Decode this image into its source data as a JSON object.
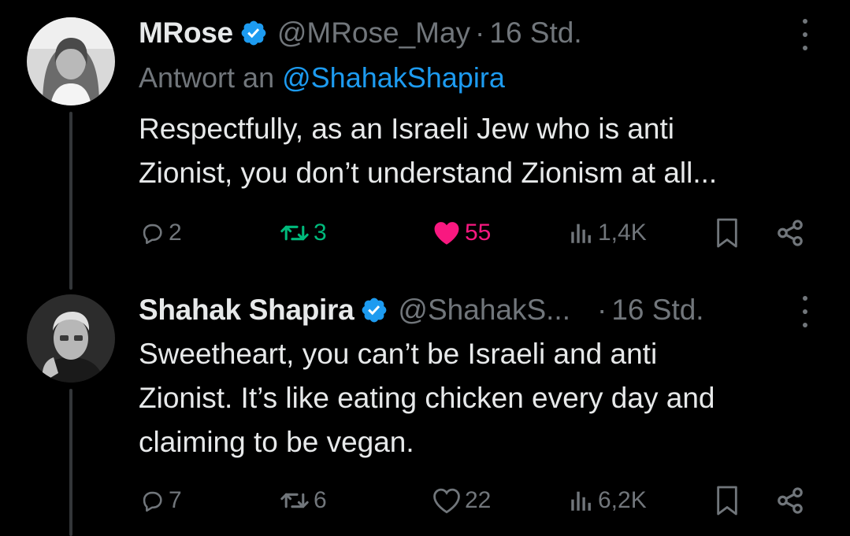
{
  "tweets": [
    {
      "display_name": "MRose",
      "handle": "@MRose_May",
      "separator": "·",
      "time": "16 Std.",
      "reply_prefix": "Antwort an",
      "reply_mention": "@ShahakShapira",
      "text_lines": [
        "Respectfully, as an Israeli Jew who is anti",
        "Zionist, you don’t understand Zionism at all..."
      ],
      "replies": "2",
      "retweets": "3",
      "likes": "55",
      "views": "1,4K",
      "retweeted": true,
      "liked": true,
      "avatar_icon": "woman-portrait-avatar"
    },
    {
      "display_name": "Shahak Shapira",
      "handle": "@ShahakS...",
      "separator": "·",
      "time": "16 Std.",
      "text_lines": [
        "Sweetheart, you can’t be Israeli and anti",
        "Zionist. It’s like eating chicken every day and",
        "claiming to be vegan."
      ],
      "replies": "7",
      "retweets": "6",
      "likes": "22",
      "views": "6,2K",
      "retweeted": false,
      "liked": false,
      "avatar_icon": "man-portrait-avatar"
    }
  ],
  "colors": {
    "background": "#000000",
    "text": "#e7e9ea",
    "muted": "#71767b",
    "link": "#1d9bf0",
    "verified": "#1d9bf0",
    "retweet_active": "#00ba7c",
    "like_active": "#f91880",
    "thread_line": "#333639"
  },
  "icons": [
    "verified-badge-icon",
    "more-icon",
    "reply-icon",
    "retweet-icon",
    "like-icon",
    "views-icon",
    "bookmark-icon",
    "share-icon"
  ]
}
